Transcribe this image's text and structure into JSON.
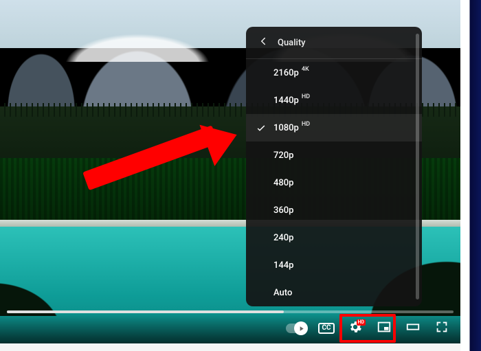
{
  "menu": {
    "title": "Quality",
    "options": [
      {
        "label": "2160p",
        "badge": "4K",
        "selected": false
      },
      {
        "label": "1440p",
        "badge": "HD",
        "selected": false
      },
      {
        "label": "1080p",
        "badge": "HD",
        "selected": true
      },
      {
        "label": "720p",
        "badge": "",
        "selected": false
      },
      {
        "label": "480p",
        "badge": "",
        "selected": false
      },
      {
        "label": "360p",
        "badge": "",
        "selected": false
      },
      {
        "label": "240p",
        "badge": "",
        "selected": false
      },
      {
        "label": "144p",
        "badge": "",
        "selected": false
      },
      {
        "label": "Auto",
        "badge": "",
        "selected": false
      }
    ]
  },
  "controls": {
    "cc_label": "CC",
    "settings_badge": "HD"
  },
  "annotation": {
    "highlight_target": "settings-button"
  }
}
